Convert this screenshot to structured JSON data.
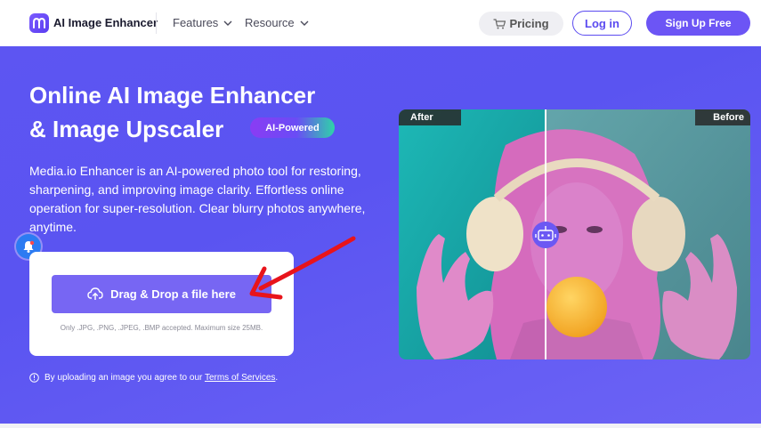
{
  "header": {
    "logo_text": "AI Image Enhancer",
    "nav": [
      "Features",
      "Resource"
    ],
    "pricing_label": "Pricing",
    "login_label": "Log in",
    "signup_label": "Sign Up Free"
  },
  "hero": {
    "title_line1": "Online AI Image Enhancer",
    "title_line2": "& Image Upscaler",
    "badge": "AI-Powered",
    "description": "Media.io Enhancer is an AI-powered photo tool for restoring, sharpening, and improving image clarity. Effortless online operation for super-resolution. Clear blurry photos anywhere, anytime.",
    "upload": {
      "button_label": "Drag & Drop a file here",
      "note": "Only .JPG, .PNG, .JPEG, .BMP accepted. Maximum size 25MB."
    },
    "terms_text": "By uploading an image you agree to our",
    "terms_link": "Terms of Services",
    "terms_end": "."
  },
  "compare": {
    "after_label": "After",
    "before_label": "Before"
  },
  "colors": {
    "brand": "#6c55f5",
    "hero_bg": "#5d55f2",
    "annotation_arrow": "#e8141b"
  },
  "icons": [
    "media-io-logo-icon",
    "chevron-down-icon",
    "cart-icon",
    "bell-icon",
    "cloud-upload-icon",
    "info-icon",
    "robot-icon"
  ]
}
